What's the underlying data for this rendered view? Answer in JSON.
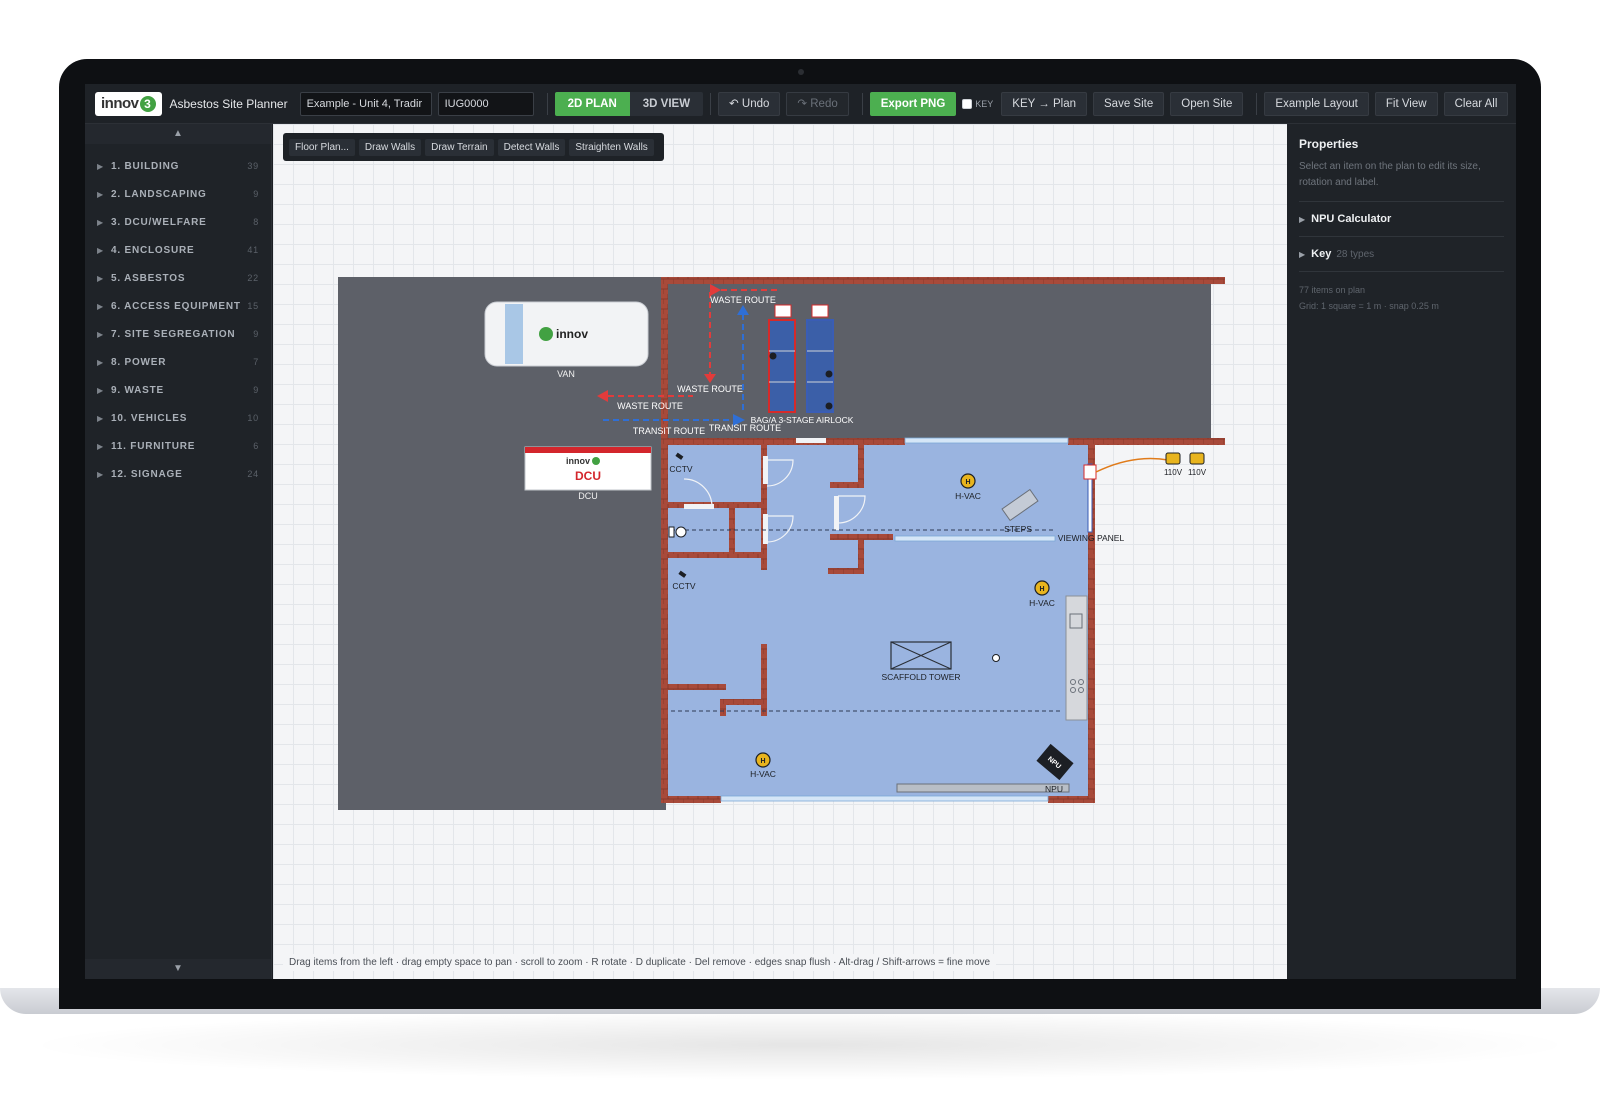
{
  "app": {
    "logo_text": "innov",
    "logo_badge": "3",
    "title": "Asbestos Site Planner",
    "site_name": "Example - Unit 4, Tradir",
    "site_code": "IUG0000"
  },
  "toolbar": {
    "view_2d": "2D PLAN",
    "view_3d": "3D VIEW",
    "undo": "↶ Undo",
    "redo": "↷ Redo",
    "export": "Export PNG",
    "key_toggle": "KEY",
    "key_to_plan": "KEY → Plan",
    "save": "Save Site",
    "open": "Open Site",
    "example": "Example Layout",
    "fit": "Fit View",
    "clear": "Clear All"
  },
  "sidebar": {
    "scroll_up": "▲",
    "scroll_down": "▼",
    "categories": [
      {
        "label": "1. BUILDING",
        "count": "39"
      },
      {
        "label": "2. LANDSCAPING",
        "count": "9"
      },
      {
        "label": "3. DCU/WELFARE",
        "count": "8"
      },
      {
        "label": "4. ENCLOSURE",
        "count": "41"
      },
      {
        "label": "5. ASBESTOS",
        "count": "22"
      },
      {
        "label": "6. ACCESS EQUIPMENT",
        "count": "15"
      },
      {
        "label": "7. SITE SEGREGATION",
        "count": "9"
      },
      {
        "label": "8. POWER",
        "count": "7"
      },
      {
        "label": "9. WASTE",
        "count": "9"
      },
      {
        "label": "10. VEHICLES",
        "count": "10"
      },
      {
        "label": "11. FURNITURE",
        "count": "6"
      },
      {
        "label": "12. SIGNAGE",
        "count": "24"
      }
    ]
  },
  "canvas_tools": [
    "Floor Plan...",
    "Draw Walls",
    "Draw Terrain",
    "Detect Walls",
    "Straighten Walls"
  ],
  "plan_labels": {
    "van": "VAN",
    "van_logo": "innov",
    "dcu": "DCU",
    "dcu_caption": "DCU",
    "dcu_logo": "innov",
    "waste_route_1": "WASTE ROUTE",
    "waste_route_2": "WASTE ROUTE",
    "waste_route_3": "WASTE ROUTE",
    "transit_route_1": "TRANSIT ROUTE",
    "transit_route_2": "TRANSIT ROUTE",
    "airlock": "BAG/A 3-STAGE AIRLOCK",
    "cctv_1": "CCTV",
    "cctv_2": "CCTV",
    "hvac_1": "H-VAC",
    "hvac_2": "H-VAC",
    "hvac_3": "H-VAC",
    "steps": "STEPS",
    "viewing_panel": "VIEWING PANEL",
    "scaffold": "SCAFFOLD TOWER",
    "npu": "NPU",
    "npu_unit": "NPU",
    "power_1": "110V",
    "power_2": "110V"
  },
  "hint": "Drag items from the left · drag empty space to pan · scroll to zoom · R rotate · D duplicate · Del remove · edges snap flush · Alt-drag / Shift-arrows = fine move",
  "properties": {
    "title": "Properties",
    "description": "Select an item on the plan to edit its size, rotation and label.",
    "npu_calculator": "NPU Calculator",
    "key_label": "Key",
    "key_types": "28 types",
    "items_count": "77 items on plan",
    "grid_info": "Grid: 1 square = 1 m · snap 0.25 m"
  },
  "colors": {
    "accent_green": "#4caf50",
    "enclosure_fill": "#9ab4e0",
    "wall": "#a84a3a",
    "terrain": "#5d6068",
    "waste_route": "#e23b3b",
    "transit_route": "#2f6fd6"
  }
}
